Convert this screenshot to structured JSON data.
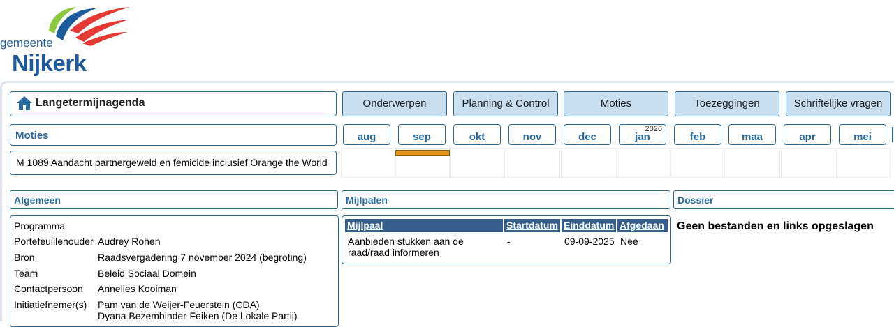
{
  "logo": {
    "line1": "gemeente",
    "line2": "Nijkerk",
    "swoosh_colors": [
      "#8cc63f",
      "#1d5a9c",
      "#e53935"
    ]
  },
  "header": {
    "home_icon": "home-icon",
    "title": "Langetermijnagenda"
  },
  "nav": [
    {
      "label": "Onderwerpen"
    },
    {
      "label": "Planning & Control"
    },
    {
      "label": "Moties"
    },
    {
      "label": "Toezeggingen"
    },
    {
      "label": "Schriftelijke vragen"
    }
  ],
  "list_heading": "Moties",
  "months": [
    {
      "label": "aug",
      "year": ""
    },
    {
      "label": "sep",
      "year": ""
    },
    {
      "label": "okt",
      "year": ""
    },
    {
      "label": "nov",
      "year": ""
    },
    {
      "label": "dec",
      "year": ""
    },
    {
      "label": "jan",
      "year": "2026"
    },
    {
      "label": "feb",
      "year": ""
    },
    {
      "label": "maa",
      "year": ""
    },
    {
      "label": "apr",
      "year": ""
    },
    {
      "label": "mei",
      "year": ""
    }
  ],
  "item": {
    "text": "M   1089  Aandacht partnergeweld en femicide inclusief Orange the World",
    "bar_month": "sep",
    "bar_color": "#e5971d"
  },
  "sections": {
    "algemeen": "Algemeen",
    "mijlpalen": "Mijlpalen",
    "dossier": "Dossier"
  },
  "algemeen": {
    "programma_label": "Programma",
    "programma_value": "",
    "portefeuille_label": "Portefeuillehouder",
    "portefeuille_value": "Audrey Rohen",
    "bron_label": "Bron",
    "bron_value": "Raadsvergadering 7 november 2024 (begroting)",
    "team_label": "Team",
    "team_value": "Beleid Sociaal Domein",
    "contact_label": "Contactpersoon",
    "contact_value": "Annelies Kooiman",
    "initiatief_label": "Initiatiefnemer(s)",
    "initiatief_value_1": "Pam van de Weijer-Feuerstein (CDA)",
    "initiatief_value_2": "Dyana Bezembinder-Feiken (De Lokale Partij)"
  },
  "mijlpalen": {
    "columns": [
      "Mijlpaal",
      "Startdatum",
      "Einddatum",
      "Afgedaan"
    ],
    "rows": [
      {
        "mijlpaal_line1": "Aanbieden stukken aan de",
        "mijlpaal_line2": "raad/raad informeren",
        "start": "-",
        "eind": "09-09-2025",
        "afgedaan": "Nee"
      }
    ]
  },
  "dossier": {
    "empty_text": "Geen bestanden en links opgeslagen"
  },
  "colors": {
    "accent": "#2a6aa0",
    "nav_bg": "#c9dff0",
    "table_header": "#365f8e"
  }
}
